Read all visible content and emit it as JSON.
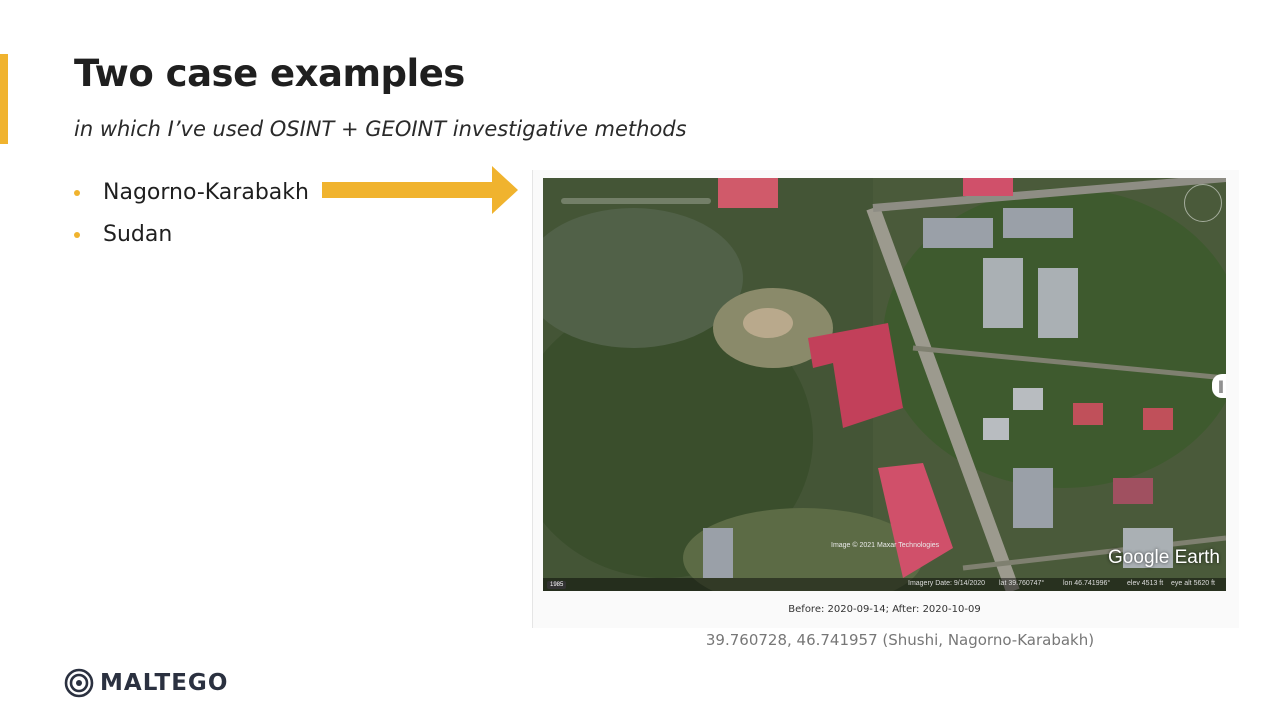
{
  "slide": {
    "title": "Two case examples",
    "subtitle": "in which I’ve used OSINT + GEOINT investigative methods",
    "bullets": [
      {
        "label": "Nagorno-Karabakh"
      },
      {
        "label": "Sudan"
      }
    ],
    "accent_color": "#F0B32E"
  },
  "map_view": {
    "app_logo": "Google Earth",
    "copyright": "Image © 2021 Maxar Technologies",
    "history_year": "1985",
    "imagery_date": "Imagery Date: 9/14/2020",
    "lat": "lat  39.760747°",
    "lon": "lon  46.741996°",
    "elev": "elev  4513 ft",
    "eye_alt": "eye alt  5620 ft",
    "timeline_label": "9/14/2020",
    "icons": [
      "compass-icon",
      "history-clock-icon",
      "swipe-handle-icon",
      "nav-circle-icon"
    ]
  },
  "captions": {
    "dates": "Before: 2020-09-14; After: 2020-10-09",
    "coords": "39.760728,  46.741957  (Shushi, Nagorno-Karabakh)"
  },
  "brand": {
    "name": "MALTEGO"
  }
}
